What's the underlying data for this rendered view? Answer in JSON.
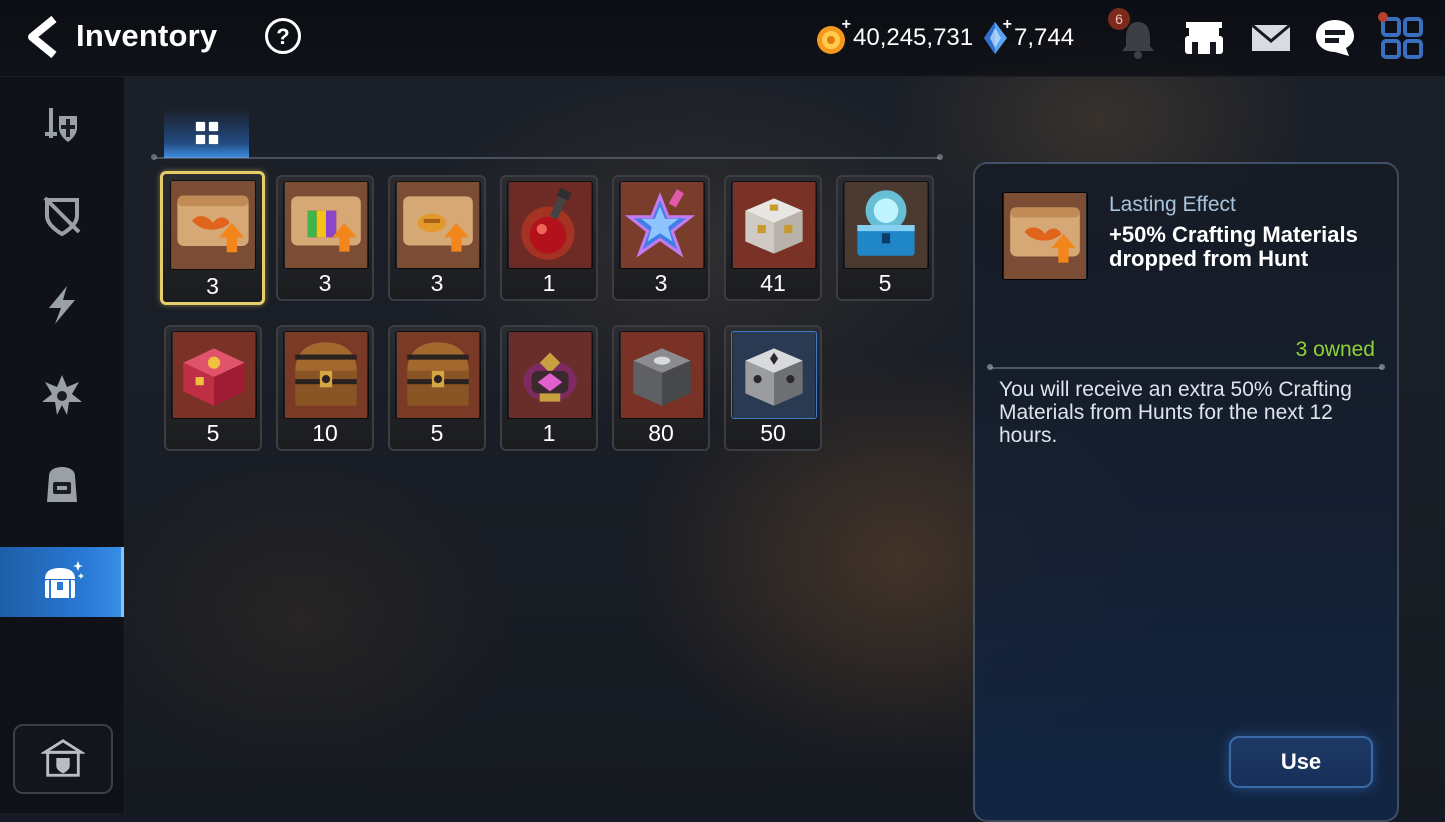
{
  "header": {
    "title": "Inventory",
    "gold": "40,245,731",
    "crystals": "7,744",
    "notification_count": "6"
  },
  "sidebar": {
    "items": [
      {
        "icon": "sword-shield-icon"
      },
      {
        "icon": "crossed-shield-icon"
      },
      {
        "icon": "lightning-icon"
      },
      {
        "icon": "spiky-emblem-icon"
      },
      {
        "icon": "backpack-icon"
      },
      {
        "icon": "treasure-chest-icon",
        "active": true
      }
    ],
    "bottom_icon": "castle-icon"
  },
  "tab": {
    "icon": "grid-icon"
  },
  "items": [
    {
      "name": "crafting-scroll",
      "qty": "3",
      "selected": true
    },
    {
      "name": "rainbow-scroll",
      "qty": "3"
    },
    {
      "name": "gold-scroll",
      "qty": "3"
    },
    {
      "name": "red-potion",
      "qty": "1"
    },
    {
      "name": "star-potion",
      "qty": "3"
    },
    {
      "name": "silver-chest",
      "qty": "41"
    },
    {
      "name": "blue-crystal-chest",
      "qty": "5"
    },
    {
      "name": "red-chest",
      "qty": "5"
    },
    {
      "name": "wooden-treasure-chest",
      "qty": "10"
    },
    {
      "name": "wooden-treasure-chest-2",
      "qty": "5"
    },
    {
      "name": "lantern",
      "qty": "1"
    },
    {
      "name": "stone-box",
      "qty": "80"
    },
    {
      "name": "silver-box",
      "qty": "50"
    }
  ],
  "detail": {
    "type": "Lasting Effect",
    "name": "+50% Crafting Materials dropped from Hunt",
    "owned": "3 owned",
    "description": "You will receive an extra 50% Crafting Materials from Hunts for the next 12 hours.",
    "use_label": "Use"
  }
}
